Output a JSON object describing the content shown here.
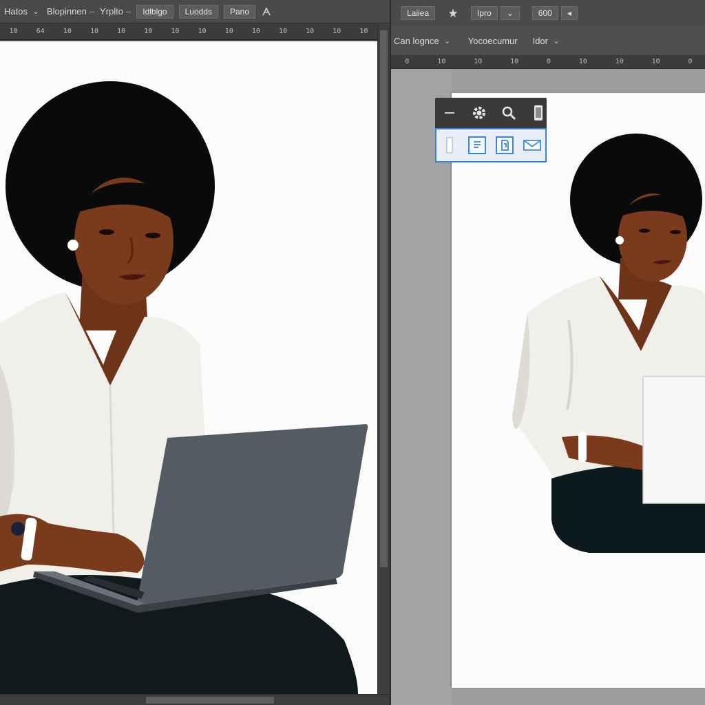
{
  "left_toolbar": {
    "items": [
      "Hatos",
      "Blopinnen",
      "Yrplto",
      "Idlblgo",
      "Luodds",
      "Pano"
    ],
    "separator": "–"
  },
  "left_ruler": {
    "ticks": [
      "10",
      "64",
      "10",
      "10",
      "10",
      "10",
      "10",
      "10",
      "10",
      "10",
      "10",
      "10",
      "10",
      "10"
    ]
  },
  "right_toolbar": {
    "tab_label": "Laiiea",
    "zoom_box": "Ipro",
    "size_box": "600"
  },
  "right_subbar": {
    "items": [
      "Can lognce",
      "Yocoecumur",
      "Idor"
    ]
  },
  "right_ruler": {
    "ticks": [
      "0",
      "10",
      "10",
      "10",
      "0",
      "10",
      "10",
      "10",
      "0"
    ]
  },
  "palette": {
    "icons": [
      "gear-icon",
      "zoom-icon",
      "phone-icon",
      "note-icon",
      "file-icon",
      "mail-icon"
    ]
  },
  "colors": {
    "ui_dark": "#4a4a4a",
    "canvas": "#fbfbfb",
    "accent": "#3a83d8",
    "skin": "#7a3a1c",
    "hair": "#0a0a0a",
    "blouse": "#f0efea",
    "laptop": "#545b62"
  }
}
